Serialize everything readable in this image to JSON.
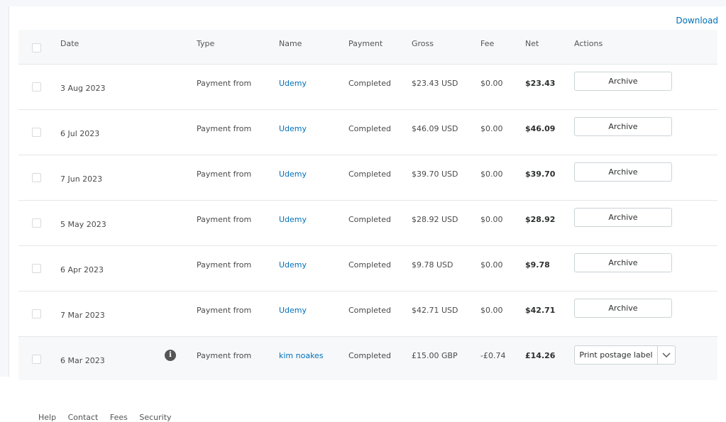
{
  "toolbar": {
    "download_label": "Download"
  },
  "table": {
    "headers": {
      "date": "Date",
      "type": "Type",
      "name": "Name",
      "payment": "Payment",
      "gross": "Gross",
      "fee": "Fee",
      "net": "Net",
      "actions": "Actions"
    },
    "rows": [
      {
        "date": "3 Aug 2023",
        "type": "Payment from",
        "name": "Udemy",
        "payment": "Completed",
        "gross": "$23.43 USD",
        "fee": "$0.00",
        "net": "$23.43",
        "action": "Archive"
      },
      {
        "date": "6 Jul 2023",
        "type": "Payment from",
        "name": "Udemy",
        "payment": "Completed",
        "gross": "$46.09 USD",
        "fee": "$0.00",
        "net": "$46.09",
        "action": "Archive"
      },
      {
        "date": "7 Jun 2023",
        "type": "Payment from",
        "name": "Udemy",
        "payment": "Completed",
        "gross": "$39.70 USD",
        "fee": "$0.00",
        "net": "$39.70",
        "action": "Archive"
      },
      {
        "date": "5 May 2023",
        "type": "Payment from",
        "name": "Udemy",
        "payment": "Completed",
        "gross": "$28.92 USD",
        "fee": "$0.00",
        "net": "$28.92",
        "action": "Archive"
      },
      {
        "date": "6 Apr 2023",
        "type": "Payment from",
        "name": "Udemy",
        "payment": "Completed",
        "gross": "$9.78 USD",
        "fee": "$0.00",
        "net": "$9.78",
        "action": "Archive"
      },
      {
        "date": "7 Mar 2023",
        "type": "Payment from",
        "name": "Udemy",
        "payment": "Completed",
        "gross": "$42.71 USD",
        "fee": "$0.00",
        "net": "$42.71",
        "action": "Archive"
      },
      {
        "date": "6 Mar 2023",
        "type": "Payment from",
        "name": "kim noakes",
        "payment": "Completed",
        "gross": "£15.00 GBP",
        "fee": "-£0.74",
        "net": "£14.26",
        "action": "Print postage label",
        "info_icon": "info-icon"
      }
    ]
  },
  "footer": {
    "links": [
      "Help",
      "Contact",
      "Fees",
      "Security"
    ]
  },
  "colors": {
    "link": "#0070ba",
    "border": "#e4e6e8",
    "header_bg": "#f7f8f9"
  }
}
